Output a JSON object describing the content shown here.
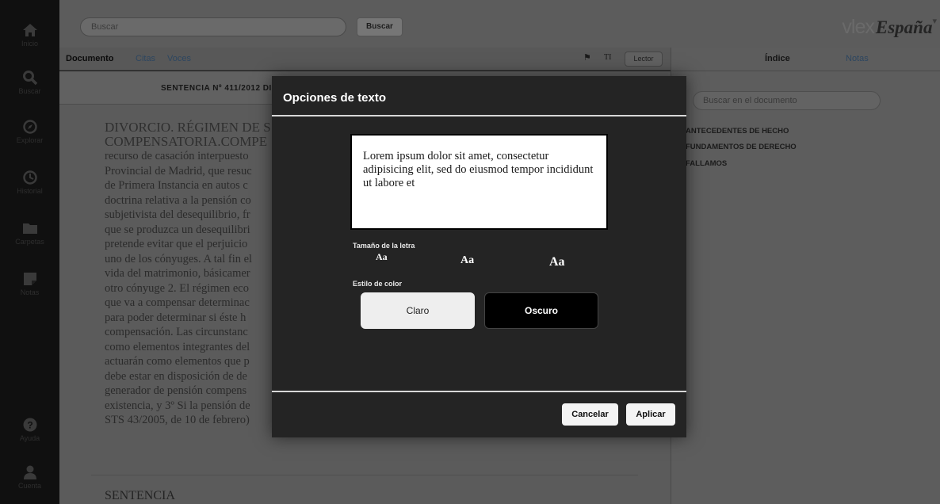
{
  "sidebar": {
    "items": [
      {
        "label": "Inicio",
        "icon": "home-icon"
      },
      {
        "label": "Buscar",
        "icon": "search-icon"
      },
      {
        "label": "Explorar",
        "icon": "compass-icon"
      },
      {
        "label": "Historial",
        "icon": "history-icon"
      },
      {
        "label": "Carpetas",
        "icon": "folder-icon"
      },
      {
        "label": "Notas",
        "icon": "note-icon"
      }
    ],
    "bottom_items": [
      {
        "label": "Ayuda",
        "icon": "help-icon"
      },
      {
        "label": "Cuenta",
        "icon": "user-icon"
      }
    ]
  },
  "header": {
    "search_placeholder": "Buscar",
    "search_button": "Buscar",
    "brand_name": "vlex",
    "brand_country": "España"
  },
  "doc_tabs": {
    "documento": "Documento",
    "citas": "Citas",
    "voces": "Voces",
    "text_tool": "TI",
    "lector": "Lector"
  },
  "document": {
    "sentencia_title": "SENTENCIA Nº 411/2012 DI",
    "heading": "DIVORCIO. RÉGIMEN DE S\nCOMPENSATORIA.COMPE",
    "body_lines": "recurso de casación interpuesto\nProvincial de Madrid, que resuc\nde Primera Instancia en autos c\ndoctrina relativa a la pensión co\nsubjetivista del desequilibrio, fr\nque se produzca un desequilibri\npretende evitar que el perjuicio\nuno de los cónyuges. A tal fin el\nvida del matrimonio, básicamer\notro cónyuge 2. El régimen eco\nque va a compensar determinac\npara poder determinar si éste h\ncompensación. Las circunstanc\ncomo elementos integrantes del\nactuarán como elementos que p\ndebe estar en disposición de de\ngenerador de pensión compens\nexistencia, y 3º Si la pensión de\nSTS 43/2005, de 10 de febrero)",
    "section_title": "SENTENCIA"
  },
  "right_panel": {
    "tab_indice": "Índice",
    "tab_notas": "Notas",
    "search_placeholder": "Buscar en el documento",
    "toc": [
      "ANTECEDENTES DE HECHO",
      "FUNDAMENTOS DE DERECHO",
      "FALLAMOS"
    ]
  },
  "modal": {
    "title": "Opciones de texto",
    "preview_text": "Lorem ipsum dolor sit amet, consectetur adipisicing elit, sed do eiusmod tempor incididunt ut labore et",
    "font_size_label": "Tamaño de la letra",
    "size_options": [
      "Aa",
      "Aa",
      "Aa"
    ],
    "color_style_label": "Estilo de color",
    "color_light": "Claro",
    "color_dark": "Oscuro",
    "cancel": "Cancelar",
    "apply": "Aplicar"
  },
  "colors": {
    "link": "#2d4660",
    "modal_bg": "#242424",
    "overlay_dim": "#5b5b5b"
  }
}
